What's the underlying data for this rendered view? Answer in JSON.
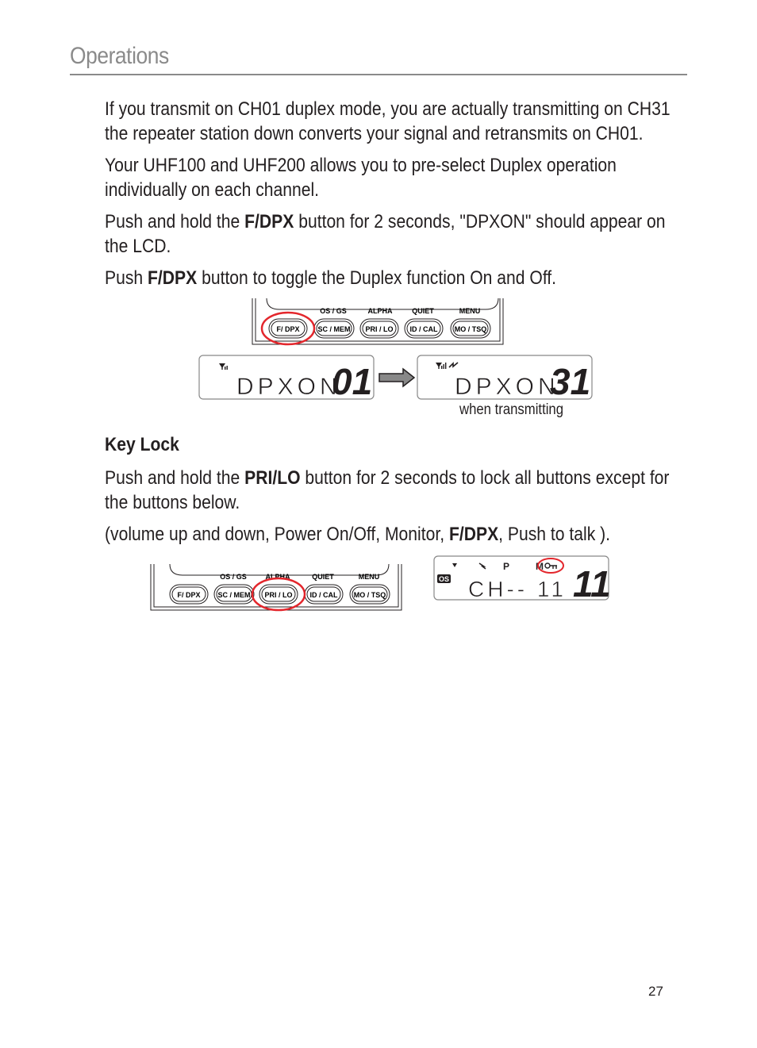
{
  "header": {
    "title": "Operations"
  },
  "paragraphs": {
    "p1": "If you transmit on CH01 duplex mode, you are actually transmitting on CH31 the repeater station down converts your signal and retransmits on CH01.",
    "p2": "Your UHF100 and UHF200 allows you to pre-select Duplex operation individually on each channel.",
    "p3_pre": "Push and hold the ",
    "p3_bold": "F/DPX",
    "p3_post": " button for 2 seconds, \"DPXON\" should appear on the LCD.",
    "p4_pre": "Push ",
    "p4_bold": "F/DPX",
    "p4_post": " button to toggle the Duplex function On and Off."
  },
  "figure1": {
    "keypad": {
      "upper_labels": [
        "OS / GS",
        "ALPHA",
        "QUIET",
        "MENU"
      ],
      "buttons": [
        "F/ DPX",
        "SC / MEM",
        "PRI / LO",
        "ID / CAL",
        "MO / TSQ"
      ],
      "highlighted_button": "F/ DPX",
      "highlight_color": "#e3262c"
    },
    "lcd_before": {
      "text": "DPXON",
      "channel": "01"
    },
    "lcd_after": {
      "text": "DPXON",
      "channel": "31"
    },
    "caption": "when transmitting"
  },
  "keylock": {
    "heading": "Key Lock",
    "p1_pre": "Push and hold the ",
    "p1_bold": "PRI/LO",
    "p1_post": " button for 2 seconds to lock all buttons except for the buttons below.",
    "p2_pre": "(volume up and down, Power On/Off, Monitor, ",
    "p2_bold": "F/DPX",
    "p2_post": ", Push to talk )."
  },
  "figure2": {
    "keypad": {
      "upper_labels": [
        "OS / GS",
        "ALPHA",
        "QUIET",
        "MENU"
      ],
      "buttons": [
        "F/ DPX",
        "SC / MEM",
        "PRI / LO",
        "ID / CAL",
        "MO / TSQ"
      ],
      "highlighted_button": "PRI / LO"
    },
    "lcd": {
      "badge": "OS",
      "indicator_p": "P",
      "indicator_m": "M",
      "key_symbol": "O−π",
      "text": "CH-- 11",
      "channel": "11"
    }
  },
  "footer": {
    "page_number": "27"
  }
}
